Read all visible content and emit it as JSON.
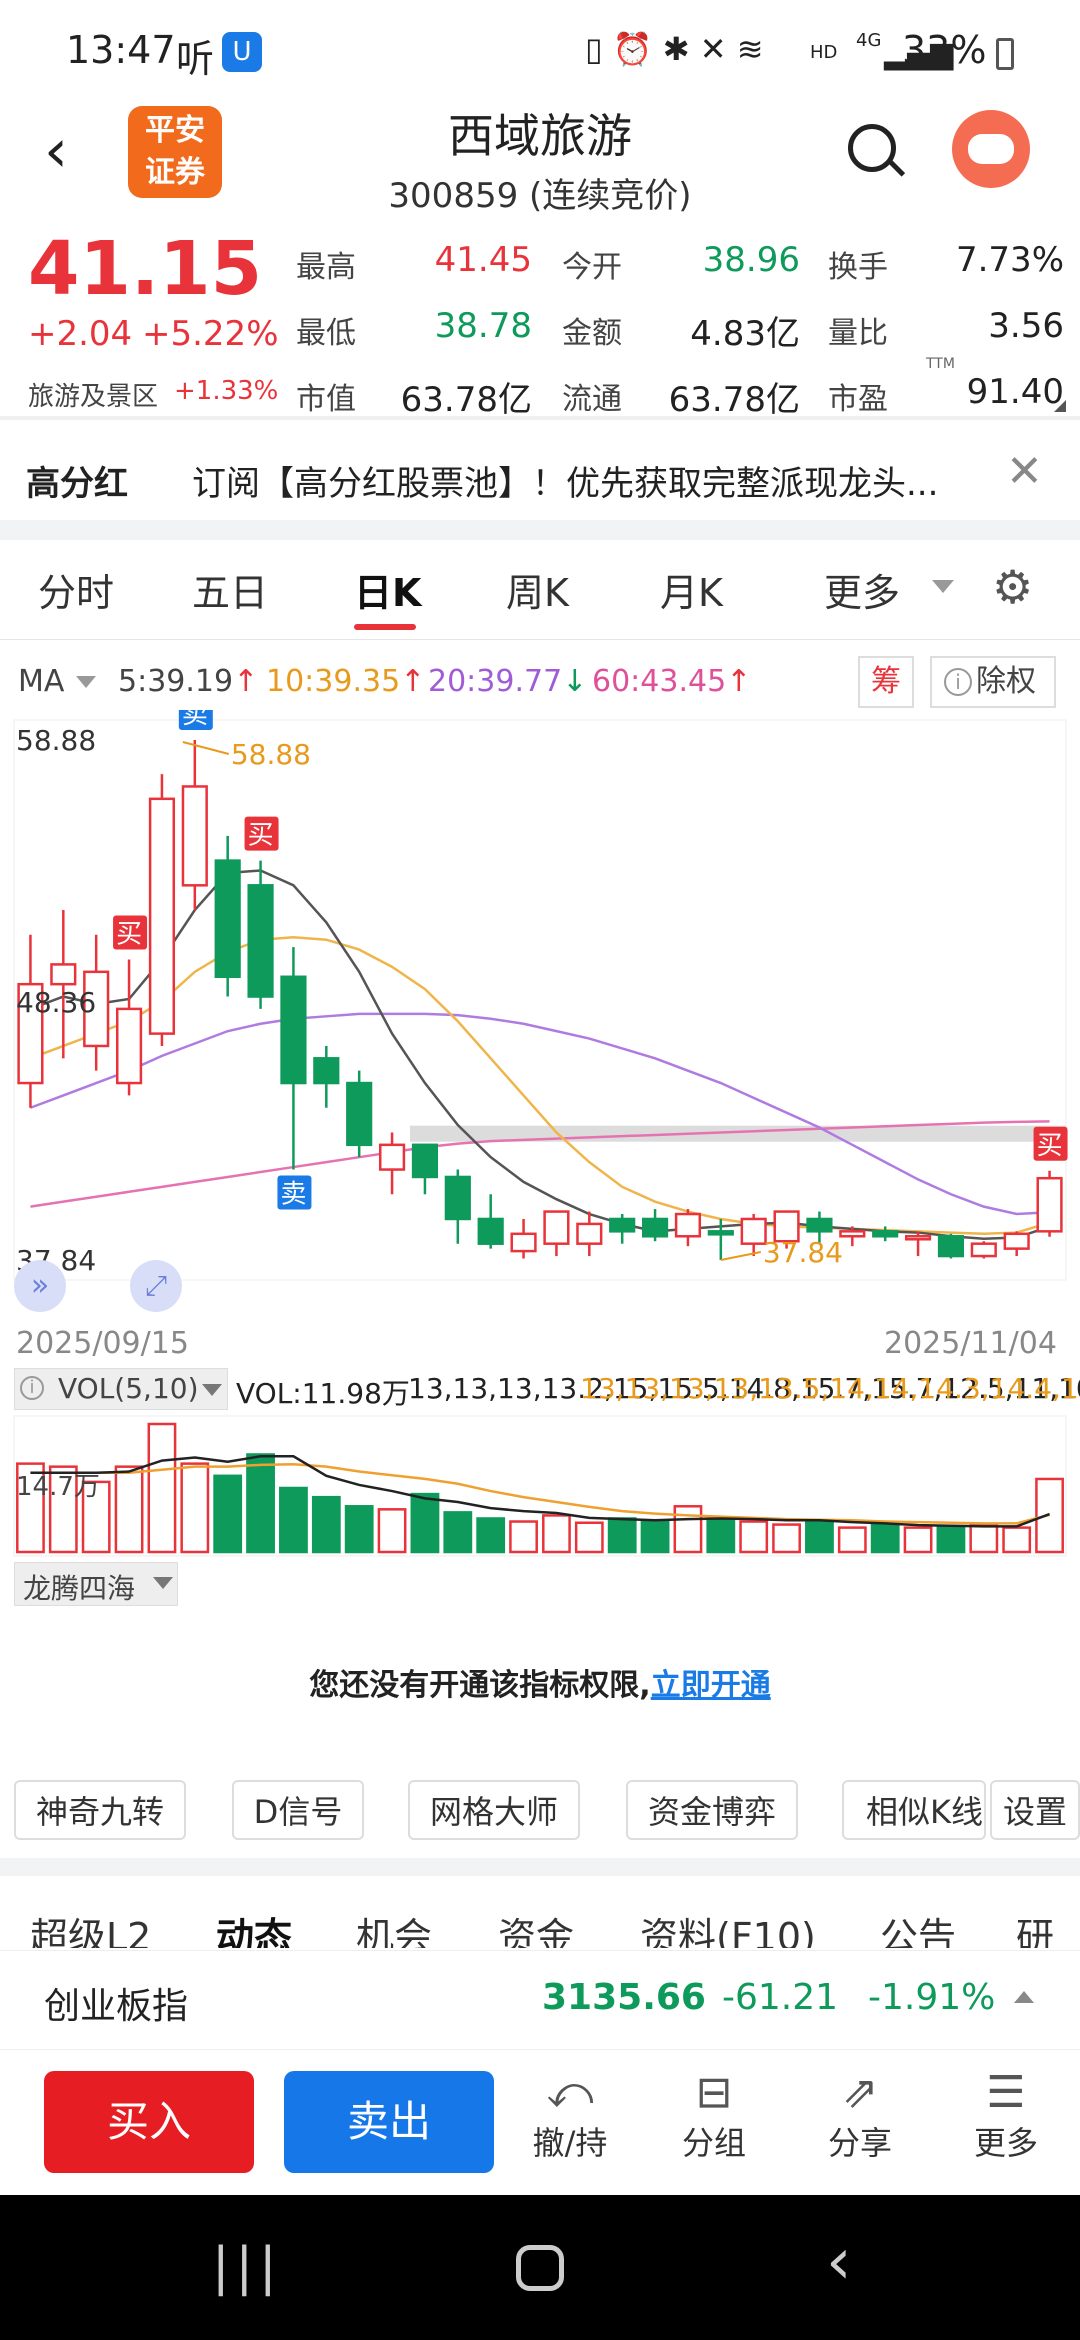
{
  "status": {
    "time": "13:47",
    "app_glyph": "听",
    "battery": "33%",
    "hd": "HD",
    "net": "4G"
  },
  "header": {
    "title": "西域旅游",
    "subtitle": "300859 (连续竞价)",
    "broker_line1": "平安",
    "broker_line2": "证券"
  },
  "quote": {
    "price": "41.15",
    "change": "+2.04",
    "change_pct": "+5.22%",
    "sector": "旅游及景区",
    "sector_pct": "+1.33%",
    "high_label": "最高",
    "high": "41.45",
    "open_label": "今开",
    "open": "38.96",
    "turnover_label": "换手",
    "turnover": "7.73%",
    "low_label": "最低",
    "low": "38.78",
    "amount_label": "金额",
    "amount": "4.83亿",
    "vol_ratio_label": "量比",
    "vol_ratio": "3.56",
    "mcap_label": "市值",
    "mcap": "63.78亿",
    "float_label": "流通",
    "float": "63.78亿",
    "pe_label": "市盈",
    "pe_sup": "TTM",
    "pe": "91.40"
  },
  "banner": {
    "tag": "高分红",
    "text": "订阅【高分红股票池】！优先获取完整派现龙头..."
  },
  "tabs": [
    "分时",
    "五日",
    "日K",
    "周K",
    "月K",
    "更多"
  ],
  "ma": {
    "label": "MA",
    "ma5": "5:39.19",
    "ma10": "10:39.35",
    "ma20": "20:39.77",
    "ma60": "60:43.45",
    "chip_btn": "筹",
    "exright_btn": "除权"
  },
  "chart_data": {
    "type": "candlestick",
    "y_max_label": "58.88",
    "y_mid_label": "48.36",
    "y_min_label": "37.84",
    "high_annot": "58.88",
    "low_annot": "37.84",
    "start_date": "2025/09/15",
    "end_date": "2025/11/04",
    "candles": [
      {
        "o": 45.0,
        "h": 51.0,
        "l": 44.0,
        "c": 49.0
      },
      {
        "o": 49.0,
        "h": 52.0,
        "l": 46.0,
        "c": 49.8
      },
      {
        "o": 46.5,
        "h": 51.0,
        "l": 45.5,
        "c": 49.5
      },
      {
        "o": 45.0,
        "h": 50.0,
        "l": 44.5,
        "c": 48.0
      },
      {
        "o": 47.0,
        "h": 57.5,
        "l": 46.5,
        "c": 56.5
      },
      {
        "o": 53.0,
        "h": 58.88,
        "l": 52.0,
        "c": 57.0
      },
      {
        "o": 54.0,
        "h": 55.0,
        "l": 48.5,
        "c": 49.3
      },
      {
        "o": 53.0,
        "h": 54.0,
        "l": 48.0,
        "c": 48.5
      },
      {
        "o": 49.3,
        "h": 50.5,
        "l": 41.5,
        "c": 45.0
      },
      {
        "o": 46.0,
        "h": 46.5,
        "l": 44.0,
        "c": 45.0
      },
      {
        "o": 45.0,
        "h": 45.5,
        "l": 42.0,
        "c": 42.5
      },
      {
        "o": 41.5,
        "h": 43.0,
        "l": 40.5,
        "c": 42.5
      },
      {
        "o": 42.5,
        "h": 42.5,
        "l": 40.5,
        "c": 41.2
      },
      {
        "o": 41.2,
        "h": 41.5,
        "l": 38.5,
        "c": 39.5
      },
      {
        "o": 39.5,
        "h": 40.5,
        "l": 38.3,
        "c": 38.5
      },
      {
        "o": 38.2,
        "h": 39.5,
        "l": 37.9,
        "c": 38.9
      },
      {
        "o": 38.5,
        "h": 39.8,
        "l": 38.0,
        "c": 39.8
      },
      {
        "o": 38.5,
        "h": 39.8,
        "l": 38.0,
        "c": 39.3
      },
      {
        "o": 39.5,
        "h": 39.7,
        "l": 38.5,
        "c": 39.0
      },
      {
        "o": 39.5,
        "h": 39.9,
        "l": 38.6,
        "c": 38.8
      },
      {
        "o": 38.8,
        "h": 39.9,
        "l": 38.4,
        "c": 39.7
      },
      {
        "o": 39.0,
        "h": 39.5,
        "l": 37.84,
        "c": 38.9
      },
      {
        "o": 38.5,
        "h": 39.7,
        "l": 38.0,
        "c": 39.5
      },
      {
        "o": 38.6,
        "h": 39.8,
        "l": 38.3,
        "c": 39.8
      },
      {
        "o": 39.5,
        "h": 39.8,
        "l": 38.5,
        "c": 39.0
      },
      {
        "o": 38.8,
        "h": 39.2,
        "l": 38.4,
        "c": 39.0
      },
      {
        "o": 39.0,
        "h": 39.2,
        "l": 38.6,
        "c": 38.8
      },
      {
        "o": 38.8,
        "h": 39.0,
        "l": 38.0,
        "c": 38.8
      },
      {
        "o": 38.8,
        "h": 38.9,
        "l": 37.9,
        "c": 38.0
      },
      {
        "o": 38.0,
        "h": 38.6,
        "l": 37.9,
        "c": 38.5
      },
      {
        "o": 38.3,
        "h": 39.0,
        "l": 38.0,
        "c": 38.9
      },
      {
        "o": 39.0,
        "h": 41.45,
        "l": 38.78,
        "c": 41.15
      }
    ],
    "ma5": [
      48,
      48.5,
      48.2,
      48.4,
      50,
      52,
      53.5,
      53.6,
      53.0,
      51.5,
      49.5,
      47,
      45,
      43.3,
      42,
      41,
      40.3,
      39.7,
      39.3,
      39.0,
      39.1,
      39.2,
      39.3,
      39.35,
      39.2,
      39.1,
      39.0,
      38.95,
      38.8,
      38.7,
      38.75,
      39.19
    ],
    "ma10": [
      46,
      46.5,
      47,
      47.5,
      48.3,
      49.5,
      50.3,
      50.8,
      50.9,
      50.8,
      50.4,
      49.7,
      48.8,
      47.5,
      46,
      44.5,
      43,
      41.8,
      40.8,
      40.2,
      39.8,
      39.5,
      39.3,
      39.2,
      39.15,
      39.1,
      39.05,
      39.0,
      38.95,
      38.9,
      38.95,
      39.35
    ],
    "ma20": [
      44,
      44.5,
      45,
      45.5,
      46.1,
      46.6,
      47.1,
      47.4,
      47.6,
      47.7,
      47.8,
      47.8,
      47.8,
      47.75,
      47.6,
      47.4,
      47.1,
      46.8,
      46.4,
      46.0,
      45.5,
      45.0,
      44.4,
      43.8,
      43.2,
      42.5,
      41.8,
      41.1,
      40.5,
      40.0,
      39.7,
      39.77
    ],
    "ma60": [
      40,
      40.2,
      40.4,
      40.6,
      40.8,
      41.0,
      41.2,
      41.4,
      41.6,
      41.8,
      42.0,
      42.2,
      42.4,
      42.55,
      42.65,
      42.7,
      42.75,
      42.8,
      42.85,
      42.9,
      42.95,
      43.0,
      43.05,
      43.1,
      43.15,
      43.2,
      43.25,
      43.3,
      43.35,
      43.4,
      43.43,
      43.45
    ],
    "signals": [
      {
        "type": "卖",
        "i": 5,
        "above": true
      },
      {
        "type": "买",
        "i": 3,
        "above": true
      },
      {
        "type": "买",
        "i": 7,
        "above": true
      },
      {
        "type": "卖",
        "i": 8,
        "above": false
      },
      {
        "type": "买",
        "i": 31,
        "above": true
      }
    ],
    "resistance": 42.95,
    "volume": {
      "label": "VOL(5,10)",
      "vol": "VOL:11.98万",
      "ma5": [
        13,
        13,
        13,
        13.2,
        15,
        15.5,
        14.8,
        15.7,
        15.7,
        12.5,
        11,
        10,
        8.8,
        8.2,
        7.2,
        6.7,
        6.4,
        5.6,
        5.4,
        5.2,
        5.4,
        5.5,
        5.4,
        5.2,
        5.2,
        4.9,
        4.7,
        4.4,
        4.3,
        4.2,
        4.2,
        6.23
      ],
      "ma10": [
        13,
        13,
        13,
        13,
        13.5,
        14,
        14,
        14.3,
        14.4,
        14.0,
        13.2,
        12.6,
        12.0,
        11.2,
        10,
        9.0,
        8.2,
        7.4,
        6.7,
        6.3,
        6.0,
        5.8,
        5.6,
        5.4,
        5.3,
        5.2,
        5.0,
        4.9,
        4.8,
        4.7,
        4.7,
        6.09
      ],
      "y_label": "14.7万",
      "values": [
        14.5,
        14.0,
        11.5,
        14.0,
        21,
        14.5,
        12.5,
        16.0,
        10.5,
        9.0,
        7.5,
        7.0,
        9.5,
        6.5,
        5.5,
        5.0,
        6.0,
        4.8,
        5.5,
        5.0,
        7.5,
        5.5,
        5.0,
        4.5,
        4.8,
        4.0,
        4.5,
        4.0,
        4.0,
        4.5,
        4.0,
        11.98
      ]
    }
  },
  "indicator": {
    "name": "龙腾四海",
    "locked_text": "您还没有开通该指标权限,",
    "unlock_link": "立即开通"
  },
  "chips": [
    "神奇九转",
    "D信号",
    "网格大师",
    "资金博弈",
    "相似K线",
    "设置"
  ],
  "bottom_tabs": [
    "超级L2",
    "动态",
    "机会",
    "资金",
    "资料(F10)",
    "公告",
    "研报"
  ],
  "index": {
    "name": "创业板指",
    "value": "3135.66",
    "change": "-61.21",
    "pct": "-1.91%"
  },
  "actions": {
    "buy": "买入",
    "sell": "卖出",
    "cancel": "撤/持",
    "group": "分组",
    "share": "分享",
    "more": "更多"
  }
}
